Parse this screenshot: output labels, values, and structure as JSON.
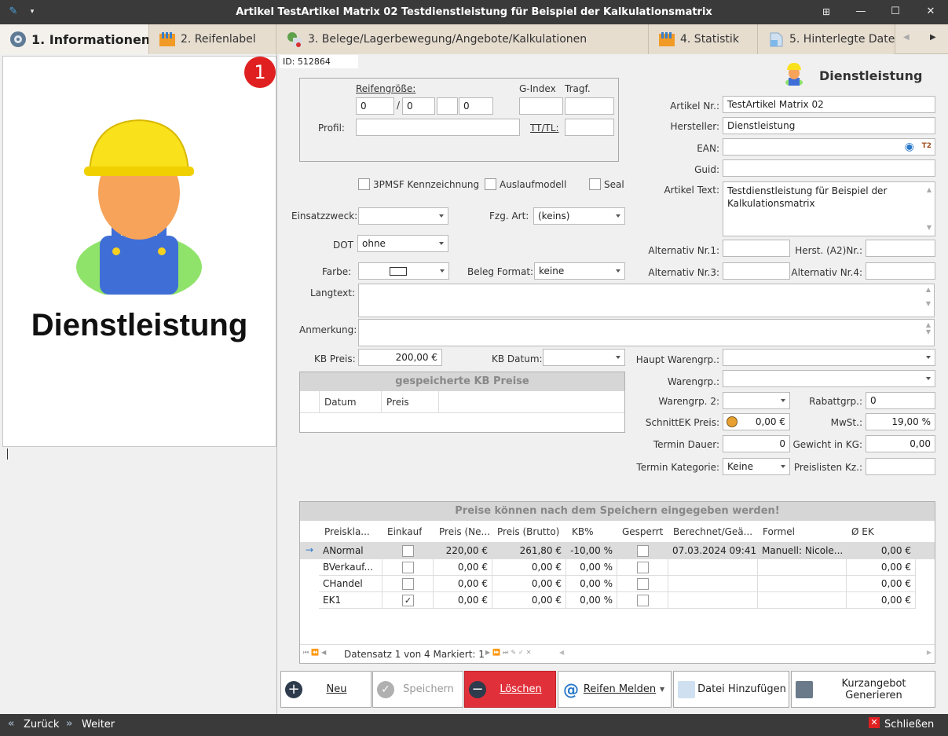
{
  "window": {
    "title": "Artikel TestArtikel Matrix 02 Testdienstleistung für Beispiel der Kalkulationsmatrix"
  },
  "tabs": [
    {
      "label": "1. Informationen",
      "icon": "tire-icon"
    },
    {
      "label": "2. Reifenlabel",
      "icon": "label-chart-icon"
    },
    {
      "label": "3. Belege/Lagerbewegung/Angebote/Kalkulationen",
      "icon": "documents-icon"
    },
    {
      "label": "4. Statistik",
      "icon": "statistics-icon"
    },
    {
      "label": "5. Hinterlegte Dateien",
      "icon": "files-icon"
    }
  ],
  "image_panel": {
    "caption": "Dienstleistung"
  },
  "badge": "1",
  "id_text": "ID: 512864",
  "type_header": "Dienstleistung",
  "tire": {
    "size_label": "Reifengröße:",
    "gindex_label": "G-Index",
    "tragf_label": "Tragf.",
    "size_slash": "/",
    "width": "0",
    "ratio": "0",
    "rim": "0",
    "profil_label": "Profil:",
    "tttl_label": "TT/TL:"
  },
  "checkboxes": {
    "pmsf": "3PMSF Kennzeichnung",
    "auslauf": "Auslaufmodell",
    "seal": "Seal"
  },
  "form": {
    "einsatz_label": "Einsatzzweck:",
    "fzg_label": "Fzg. Art:",
    "fzg_value": "(keins)",
    "dot_label": "DOT",
    "dot_value": "ohne",
    "farbe_label": "Farbe:",
    "beleg_label": "Beleg Format:",
    "beleg_value": "keine",
    "langtext_label": "Langtext:",
    "anmerkung_label": "Anmerkung:",
    "kbpreis_label": "KB Preis:",
    "kbpreis_value": "200,00 €",
    "kbdatum_label": "KB Datum:"
  },
  "kb_grid": {
    "title": "gespeicherte KB Preise",
    "columns": [
      "Datum",
      "Preis"
    ]
  },
  "article": {
    "nr_label": "Artikel Nr.:",
    "nr_value": "TestArtikel Matrix 02",
    "hersteller_label": "Hersteller:",
    "hersteller_value": "Dienstleistung",
    "ean_label": "EAN:",
    "guid_label": "Guid:",
    "text_label": "Artikel Text:",
    "text_value": "Testdienstleistung für Beispiel der Kalkulationsmatrix",
    "alt1_label": "Alternativ Nr.1:",
    "herst_label": "Herst. (A2)Nr.:",
    "alt3_label": "Alternativ Nr.3:",
    "alt4_label": "Alternativ Nr.4:",
    "hauptwg_label": "Haupt Warengrp.:",
    "wg_label": "Warengrp.:",
    "wg2_label": "Warengrp. 2:",
    "rabatt_label": "Rabattgrp.:",
    "rabatt_value": "0",
    "schnitt_label": "SchnittEK Preis:",
    "schnitt_value": "0,00 €",
    "mwst_label": "MwSt.:",
    "mwst_value": "19,00 %",
    "termin_dauer_label": "Termin Dauer:",
    "termin_dauer_value": "0",
    "gewicht_label": "Gewicht in KG:",
    "gewicht_value": "0,00",
    "termin_kat_label": "Termin Kategorie:",
    "termin_kat_value": "Keine",
    "preislisten_label": "Preislisten Kz.:"
  },
  "price_grid": {
    "title": "Preise können nach dem Speichern eingegeben werden!",
    "columns": [
      "Preiskla...",
      "Einkauf",
      "Preis (Ne...",
      "Preis (Brutto)",
      "KB%",
      "Gesperrt",
      "Berechnet/Geä...",
      "Formel",
      "Ø EK"
    ],
    "rows": [
      {
        "name": "ANormal",
        "einkauf": false,
        "netto": "220,00 €",
        "brutto": "261,80 €",
        "kb": "-10,00 %",
        "gesperrt": false,
        "berechnet": "07.03.2024 09:41",
        "formel": "Manuell: Nicole...",
        "ek": "0,00 €"
      },
      {
        "name": "BVerkauf...",
        "einkauf": false,
        "netto": "0,00 €",
        "brutto": "0,00 €",
        "kb": "0,00 %",
        "gesperrt": false,
        "berechnet": "",
        "formel": "",
        "ek": "0,00 €"
      },
      {
        "name": "CHandel",
        "einkauf": false,
        "netto": "0,00 €",
        "brutto": "0,00 €",
        "kb": "0,00 %",
        "gesperrt": false,
        "berechnet": "",
        "formel": "",
        "ek": "0,00 €"
      },
      {
        "name": "EK1",
        "einkauf": true,
        "netto": "0,00 €",
        "brutto": "0,00 €",
        "kb": "0,00 %",
        "gesperrt": false,
        "berechnet": "",
        "formel": "",
        "ek": "0,00 €"
      }
    ],
    "nav_text": "Datensatz 1 von 4 Markiert: 1"
  },
  "buttons": {
    "neu": "Neu",
    "speichern": "Speichern",
    "loeschen": "Löschen",
    "reifen_melden": "Reifen Melden",
    "datei": "Datei Hinzufügen",
    "kurzangebot": "Kurzangebot Generieren"
  },
  "status": {
    "zurueck": "Zurück",
    "weiter": "Weiter",
    "schliessen": "Schließen"
  },
  "colors": {
    "delete_button": "#e0303a",
    "badge": "#e02020",
    "titlebar": "#3a3a3a"
  }
}
